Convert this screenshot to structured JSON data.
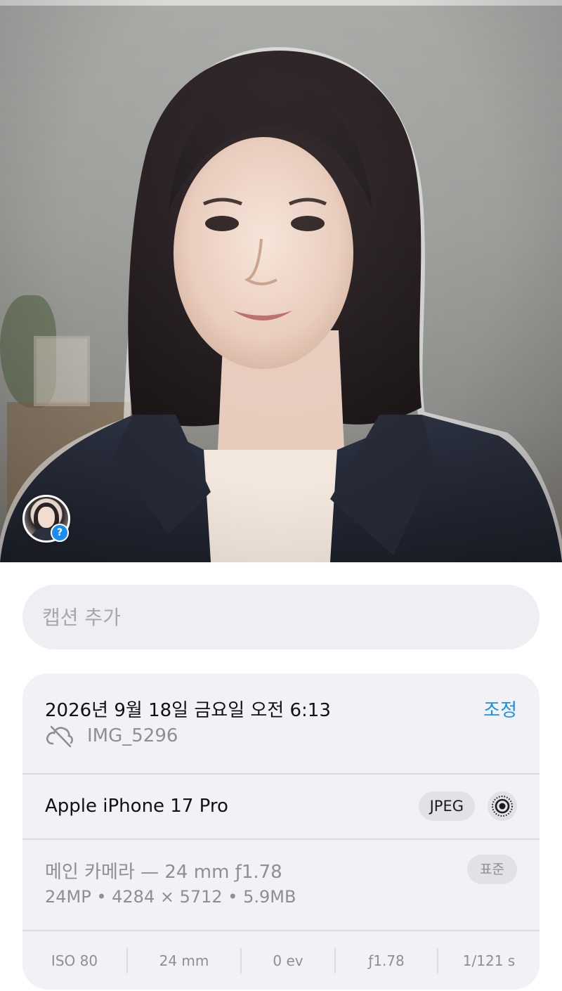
{
  "photo": {
    "face_badge": {
      "question_mark": "?"
    }
  },
  "caption": {
    "placeholder": "캡션 추가"
  },
  "info": {
    "date": "2026년 9월 18일 금요일 오전 6:13",
    "adjust_label": "조정",
    "filename": "IMG_5296",
    "device": "Apple iPhone 17 Pro",
    "format_badge": "JPEG",
    "lens": "메인 카메라 — 24 mm ƒ1.78",
    "specs": "24MP • 4284 × 5712 • 5.9MB",
    "profile_badge": "표준",
    "exif": [
      "ISO 80",
      "24 mm",
      "0 ev",
      "ƒ1.78",
      "1/121 s"
    ]
  },
  "colors": {
    "accent": "#1a8cf0",
    "card_bg": "#f2f2f6",
    "secondary_text": "#8e8e93"
  },
  "icons": {
    "cloud": "cloud-slash-icon",
    "live": "live-photo-icon",
    "people": "face-badge-icon"
  }
}
